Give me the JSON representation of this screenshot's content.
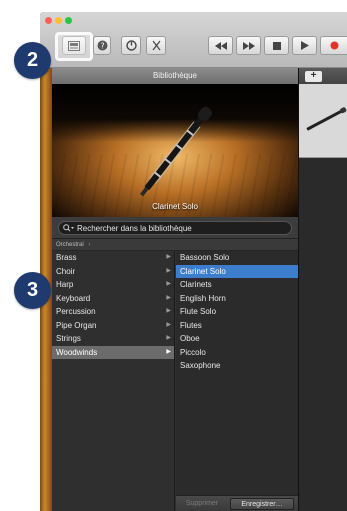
{
  "toolbar": {
    "transport_icons": [
      "rewind-icon",
      "fast-forward-icon",
      "stop-icon",
      "play-icon",
      "record-icon"
    ]
  },
  "library": {
    "title": "Bibliothèque",
    "preview_caption": "Clarinet Solo",
    "search_placeholder": "Rechercher dans la bibliothèque",
    "breadcrumb": "Orchestral",
    "categories": [
      {
        "label": "Brass"
      },
      {
        "label": "Choir"
      },
      {
        "label": "Harp"
      },
      {
        "label": "Keyboard"
      },
      {
        "label": "Percussion"
      },
      {
        "label": "Pipe Organ"
      },
      {
        "label": "Strings"
      },
      {
        "label": "Woodwinds",
        "selected": true
      }
    ],
    "patches": [
      {
        "label": "Bassoon Solo"
      },
      {
        "label": "Clarinet Solo",
        "selected": true
      },
      {
        "label": "Clarinets"
      },
      {
        "label": "English Horn"
      },
      {
        "label": "Flute Solo"
      },
      {
        "label": "Flutes"
      },
      {
        "label": "Oboe"
      },
      {
        "label": "Piccolo"
      },
      {
        "label": "Saxophone"
      }
    ],
    "delete_label": "Supprimer",
    "save_label": "Enregistrer…"
  },
  "tracks": {
    "add_label": "+"
  },
  "callouts": {
    "step_a": "2",
    "step_b": "3"
  },
  "colors": {
    "selection_blue": "#3d7ecc",
    "selection_gray": "#6c6c6c",
    "callout_navy": "#1e3a6e"
  }
}
